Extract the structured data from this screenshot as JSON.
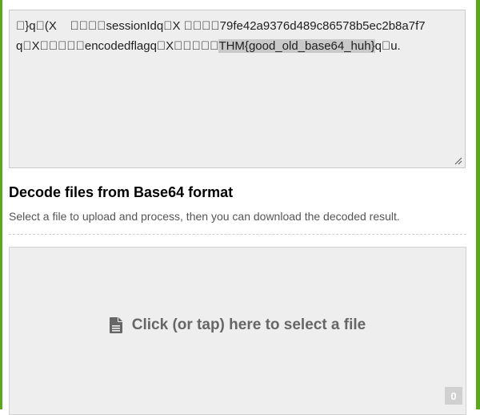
{
  "output": {
    "line1": "\u0000}q\u0000(X    \u0000\u0000\u0000\u0000sessionIdq\u0000X \u0000\u0000\u0000\u000079fe42a9376d489c86578b5ec2b8a7f7",
    "line2_prefix": "q\u0000X\u0000\u0000\u0000\u0000\u0000encodedflagq\u0000X\u0000\u0000\u0000\u0000\u0000",
    "selected": "THM{good_old_base64_huh}",
    "line2_suffix": "q\u0000u."
  },
  "decode_files": {
    "title": "Decode files from Base64 format",
    "description": "Select a file to upload and process, then you can download the decoded result."
  },
  "dropzone": {
    "label": "Click (or tap) here to select a file",
    "count": "0",
    "icon": "file-icon"
  },
  "colors": {
    "accent_border": "#5aa81b",
    "panel_bg": "#eeeeee"
  }
}
